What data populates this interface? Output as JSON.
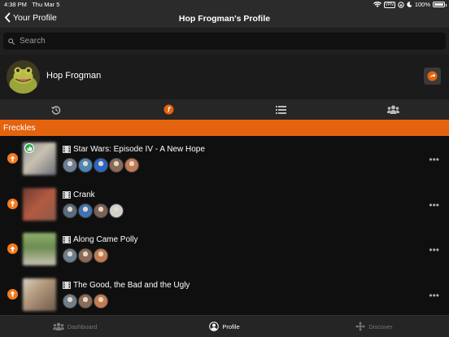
{
  "status": {
    "time": "4:38 PM",
    "date": "Thu Mar 5",
    "battery": "100%",
    "battery_level": 1.0,
    "vpn": "VPN"
  },
  "nav": {
    "back_label": "Your Profile",
    "title": "Hop Frogman's Profile"
  },
  "search": {
    "placeholder": "Search"
  },
  "profile": {
    "name": "Hop Frogman"
  },
  "tabs": [
    {
      "icon": "history-icon",
      "active": false
    },
    {
      "icon": "freckles-icon",
      "active": true
    },
    {
      "icon": "list-icon",
      "active": false
    },
    {
      "icon": "group-icon",
      "active": false
    }
  ],
  "section": {
    "title": "Freckles"
  },
  "items": [
    {
      "title": "Star Wars: Episode IV - A New Hope",
      "liked": true,
      "avatar_colors": [
        "#6b7f99",
        "#4c86b8",
        "#2c66c9",
        "#8b6b55",
        "#c27a52"
      ]
    },
    {
      "title": "Crank",
      "liked": false,
      "avatar_colors": [
        "#5a6d80",
        "#3e73b5",
        "#7a6354",
        "#d0d0d0"
      ]
    },
    {
      "title": "Along Came Polly",
      "liked": false,
      "avatar_colors": [
        "#6f7f8c",
        "#8b6a57",
        "#c47c4f"
      ]
    },
    {
      "title": "The Good, the Bad and the Ugly",
      "liked": false,
      "avatar_colors": [
        "#6f7f8c",
        "#8b6a57",
        "#c47c4f"
      ]
    }
  ],
  "bottom": {
    "dashboard": "Dashboard",
    "profile": "Profile",
    "discover": "Discover"
  },
  "colors": {
    "accent": "#e4630e",
    "vote": "#f47a20",
    "like": "#2aa84a"
  }
}
